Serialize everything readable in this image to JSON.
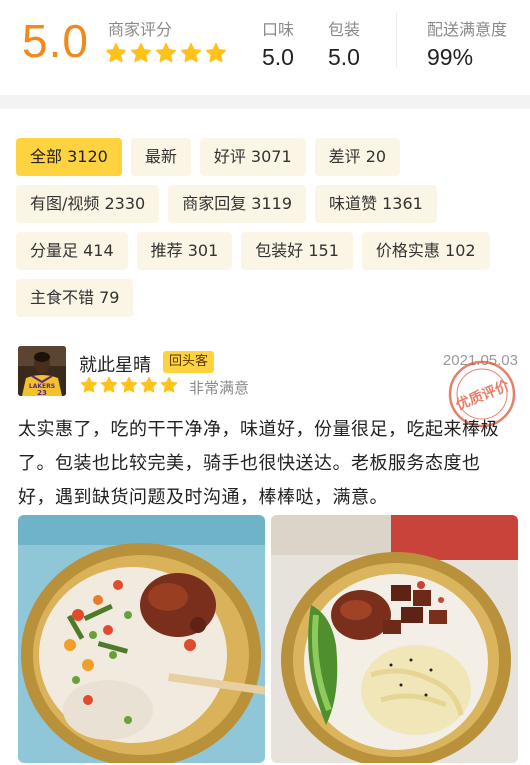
{
  "header": {
    "score": "5.0",
    "merchant_label": "商家评分",
    "stars": 5,
    "taste": {
      "label": "口味",
      "value": "5.0"
    },
    "packaging": {
      "label": "包装",
      "value": "5.0"
    },
    "delivery": {
      "label": "配送满意度",
      "value": "99%"
    }
  },
  "tags": [
    {
      "label": "全部 3120",
      "active": true
    },
    {
      "label": "最新",
      "active": false
    },
    {
      "label": "好评 3071",
      "active": false
    },
    {
      "label": "差评 20",
      "active": false
    },
    {
      "label": "有图/视频 2330",
      "active": false
    },
    {
      "label": "商家回复 3119",
      "active": false
    },
    {
      "label": "味道赞 1361",
      "active": false
    },
    {
      "label": "分量足 414",
      "active": false
    },
    {
      "label": "推荐 301",
      "active": false
    },
    {
      "label": "包装好 151",
      "active": false
    },
    {
      "label": "价格实惠 102",
      "active": false
    },
    {
      "label": "主食不错 79",
      "active": false
    }
  ],
  "review": {
    "username": "就此星晴",
    "badge": "回头客",
    "date": "2021.05.03",
    "stars": 5,
    "satisfaction": "非常满意",
    "stamp_text": "优质评价",
    "avatar_jersey_text": "LAKERS 23",
    "text": "太实惠了，吃的干干净净，味道好，份量很足，吃起来棒极了。包装也比较完美，骑手也很快送达。老板服务态度也好，遇到缺货问题及时沟通，棒棒哒，满意。",
    "photos": [
      "food-photo-rice-bowl-vegetables",
      "food-photo-rice-bowl-greens"
    ]
  },
  "colors": {
    "accent_orange": "#f08a1c",
    "star_yellow": "#ffc21a",
    "active_tag": "#ffd23f",
    "tag_bg": "#fbf5e6",
    "stamp_red": "#e0553a"
  }
}
